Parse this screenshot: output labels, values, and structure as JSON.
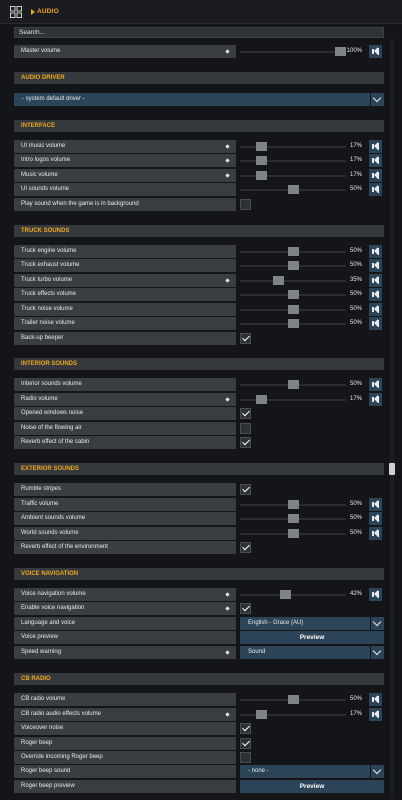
{
  "header": {
    "title": "AUDIO"
  },
  "search": {
    "value": "Search..."
  },
  "master": {
    "label": "Master volume",
    "value": "100%",
    "level": 1.0
  },
  "sections": {
    "driver": "AUDIO DRIVER",
    "interface": "INTERFACE",
    "truck": "TRUCK SOUNDS",
    "interior": "INTERIOR SOUNDS",
    "exterior": "EXTERIOR SOUNDS",
    "voice": "VOICE NAVIGATION",
    "cb": "CB RADIO"
  },
  "driver": {
    "value": "- system default driver -"
  },
  "interface": {
    "ui_music": {
      "label": "UI music volume",
      "value": "17%",
      "level": 0.17
    },
    "intro_logos": {
      "label": "Intro logos volume",
      "value": "17%",
      "level": 0.17
    },
    "music": {
      "label": "Music volume",
      "value": "17%",
      "level": 0.17
    },
    "ui_sounds": {
      "label": "UI sounds volume",
      "value": "50%",
      "level": 0.5
    },
    "background": {
      "label": "Play sound when the game is in background",
      "checked": false
    }
  },
  "truck": {
    "engine": {
      "label": "Truck engine volume",
      "value": "50%",
      "level": 0.5
    },
    "exhaust": {
      "label": "Truck exhaust volume",
      "value": "50%",
      "level": 0.5
    },
    "turbo": {
      "label": "Truck turbo volume",
      "value": "35%",
      "level": 0.35
    },
    "effects": {
      "label": "Truck effects volume",
      "value": "50%",
      "level": 0.5
    },
    "noise": {
      "label": "Truck noise volume",
      "value": "50%",
      "level": 0.5
    },
    "trailer": {
      "label": "Trailer noise volume",
      "value": "50%",
      "level": 0.5
    },
    "beeper": {
      "label": "Back-up beeper",
      "checked": true
    }
  },
  "interior": {
    "sounds": {
      "label": "Interior sounds volume",
      "value": "50%",
      "level": 0.5
    },
    "radio": {
      "label": "Radio volume",
      "value": "17%",
      "level": 0.17
    },
    "windows": {
      "label": "Opened windows noise",
      "checked": true
    },
    "air": {
      "label": "Noise of the flowing air",
      "checked": false
    },
    "reverb": {
      "label": "Reverb effect of the cabin",
      "checked": true
    }
  },
  "exterior": {
    "rumble": {
      "label": "Rumble stripes",
      "checked": true
    },
    "traffic": {
      "label": "Traffic volume",
      "value": "50%",
      "level": 0.5
    },
    "ambient": {
      "label": "Ambient sounds volume",
      "value": "50%",
      "level": 0.5
    },
    "world": {
      "label": "World sounds volume",
      "value": "50%",
      "level": 0.5
    },
    "reverb": {
      "label": "Reverb effect of the environment",
      "checked": true
    }
  },
  "voice": {
    "volume": {
      "label": "Voice navigation volume",
      "value": "42%",
      "level": 0.42
    },
    "enable": {
      "label": "Enable voice navigation",
      "checked": true
    },
    "language": {
      "label": "Language and voice",
      "value": "English - Grace (AU)"
    },
    "preview": {
      "label": "Voice preview",
      "button": "Preview"
    },
    "speed": {
      "label": "Speed warning",
      "value": "Sound"
    }
  },
  "cb": {
    "volume": {
      "label": "CB radio volume",
      "value": "50%",
      "level": 0.5
    },
    "effects": {
      "label": "CB radio audio effects volume",
      "value": "17%",
      "level": 0.17
    },
    "voiceover": {
      "label": "Voiceover noise",
      "checked": true
    },
    "roger": {
      "label": "Roger beep",
      "checked": true
    },
    "override": {
      "label": "Override incoming Roger beep",
      "checked": false
    },
    "roger_sound": {
      "label": "Roger beep sound",
      "value": "- none -"
    },
    "roger_preview": {
      "label": "Roger beep preview",
      "button": "Preview"
    }
  }
}
